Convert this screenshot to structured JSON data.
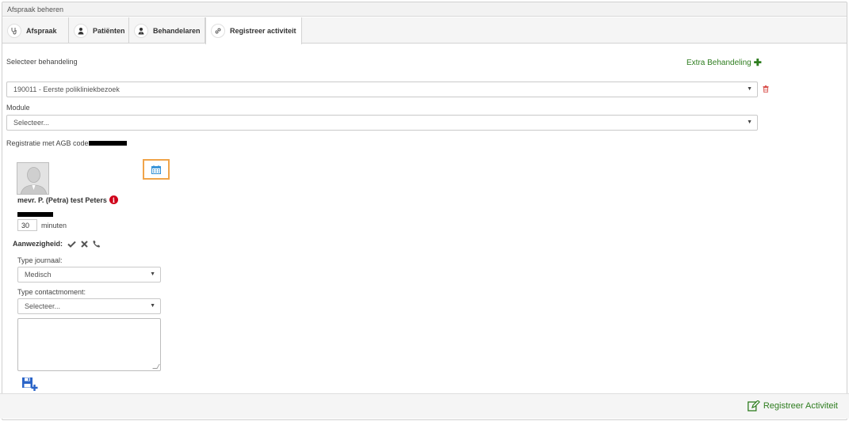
{
  "panel": {
    "title": "Afspraak beheren"
  },
  "tabs": [
    {
      "label": "Afspraak",
      "icon": "stethoscope-icon"
    },
    {
      "label": "Patiënten",
      "icon": "user-icon"
    },
    {
      "label": "Behandelaren",
      "icon": "user-md-icon"
    },
    {
      "label": "Registreer activiteit",
      "icon": "link-icon"
    }
  ],
  "form": {
    "select_treatment_label": "Selecteer behandeling",
    "extra_treatment_label": "Extra Behandeling",
    "treatment_value": "190011 - Eerste polikliniekbezoek",
    "module_label": "Module",
    "module_value": "Selecteer...",
    "agb_label": "Registratie met AGB code:"
  },
  "patient": {
    "name": "mevr. P. (Petra) test Peters",
    "duration_value": "30",
    "duration_unit": "minuten"
  },
  "attendance": {
    "label": "Aanwezigheid:"
  },
  "journal": {
    "type_label": "Type journaal:",
    "type_value": "Medisch",
    "contact_label": "Type contactmoment:",
    "contact_value": "Selecteer..."
  },
  "footer": {
    "register_label": "Registreer Activiteit"
  },
  "colors": {
    "green": "#2e7d1f",
    "highlight": "#f0a44a",
    "red": "#d0021b",
    "blue": "#2a64c8"
  }
}
